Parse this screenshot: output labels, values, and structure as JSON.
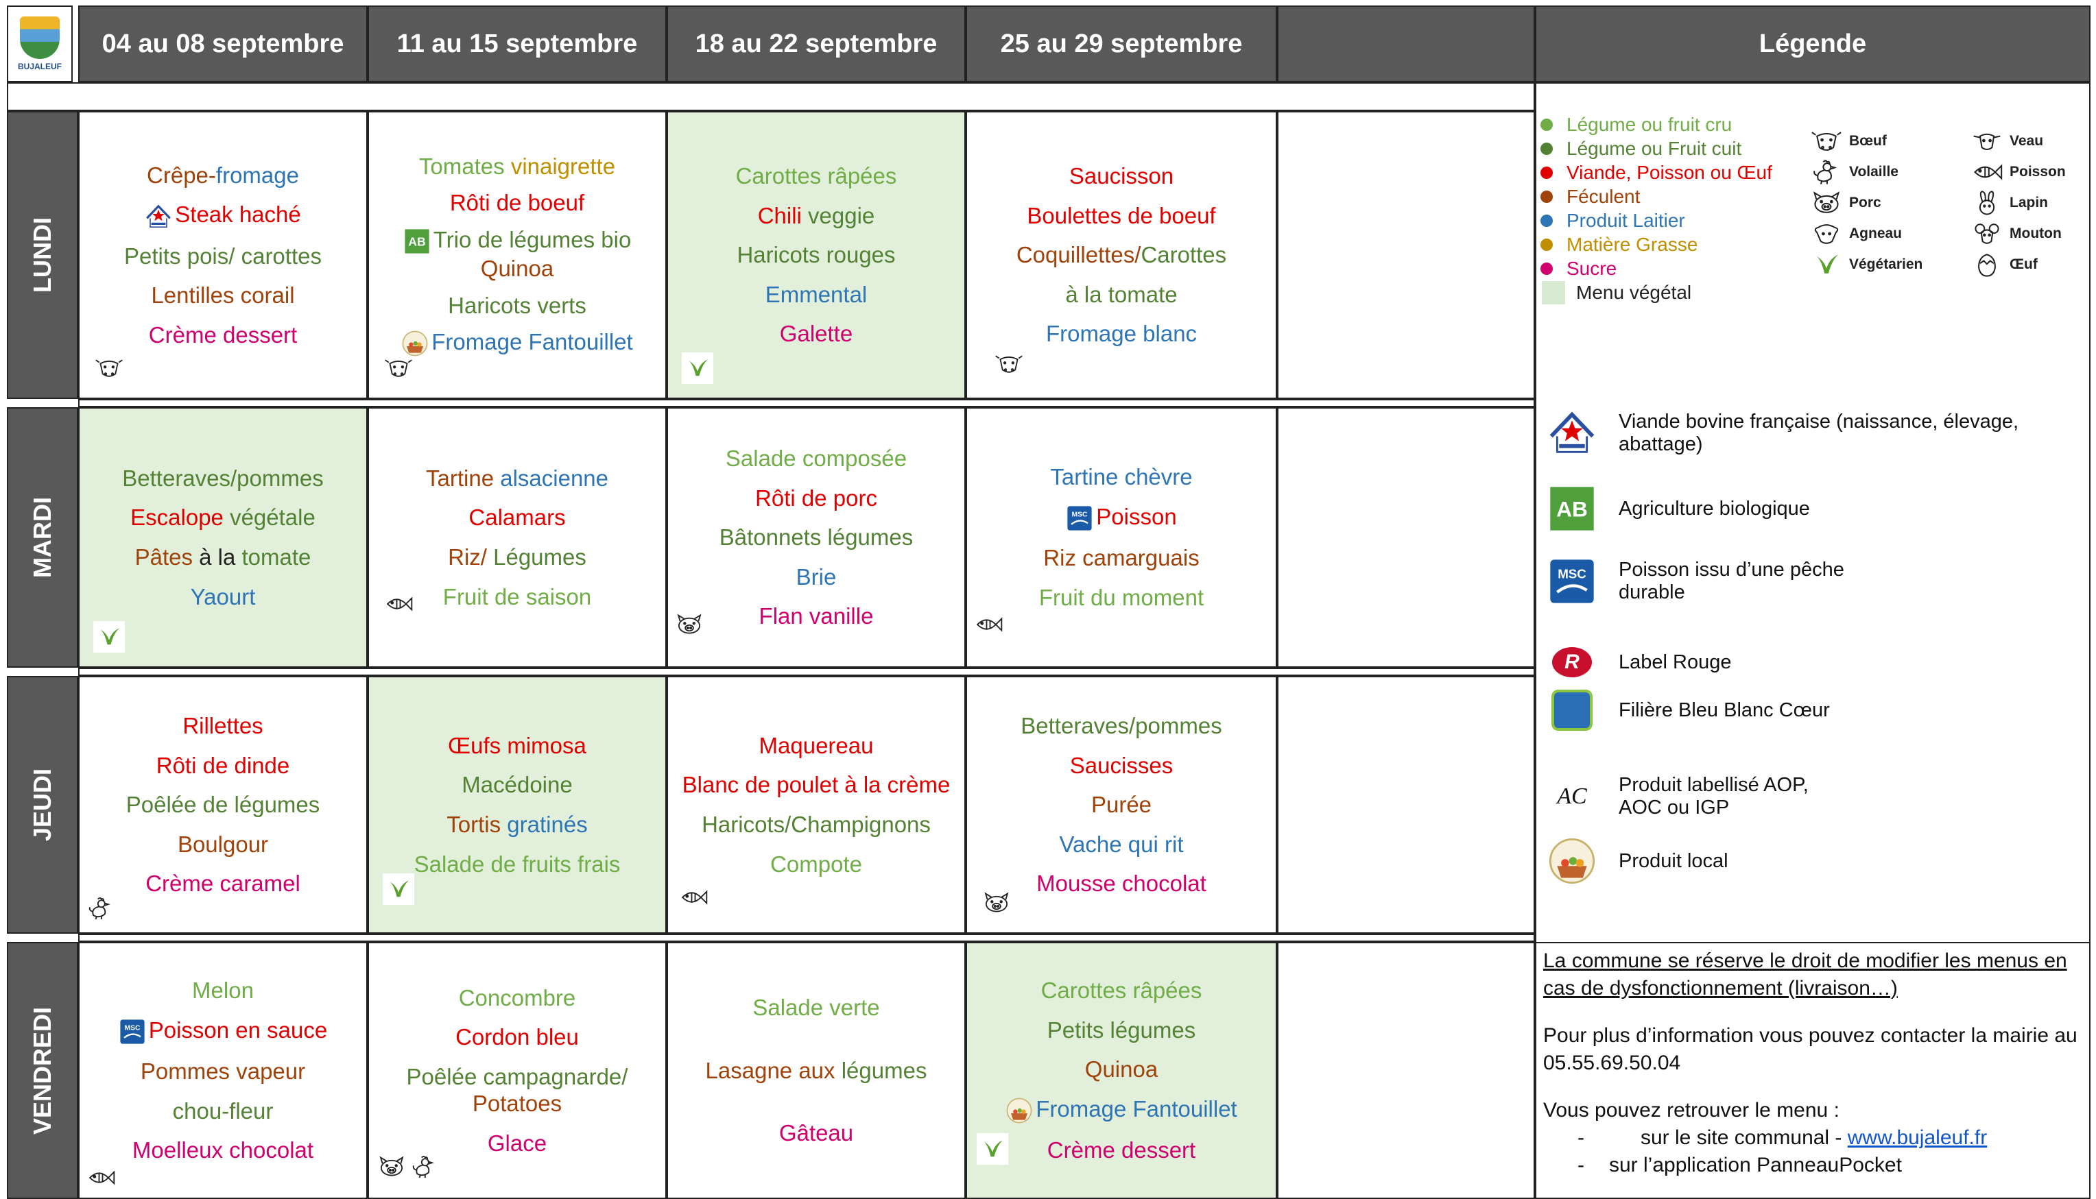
{
  "logo": {
    "text": "BUJALEUF"
  },
  "weeks": [
    "04 au 08 septembre",
    "11 au 15 septembre",
    "18 au 22 septembre",
    "25 au 29 septembre",
    ""
  ],
  "legend_title": "Légende",
  "days": [
    "LUNDI",
    "MARDI",
    "JEUDI",
    "VENDREDI"
  ],
  "colors": {
    "header_bg": "#595959",
    "vegetal_bg": "#e2efda",
    "cru": "#70ad47",
    "cuit": "#548235",
    "viande": "#e00000",
    "feculent": "#a0430a",
    "laitier": "#2e75b6",
    "grasse": "#bf8f00",
    "sucre": "#d0006f"
  },
  "menu": {
    "lundi": {
      "w1": {
        "l1a": "Crêpe-",
        "l1b": "fromage",
        "l2": "Steak haché",
        "l3": "Petits pois/ carottes",
        "l4": "Lentilles corail",
        "l5": "Crème dessert"
      },
      "w2": {
        "l1a": "Tomates ",
        "l1b": "vinaigrette",
        "l2": "Rôti de boeuf",
        "l3": "Trio de légumes bio",
        "l3b": "Quinoa",
        "l4": "Haricots verts",
        "l5": "Fromage Fantouillet"
      },
      "w3": {
        "l1": "Carottes râpées",
        "l2a": "Chili",
        "l2b": " veggie",
        "l3": "Haricots rouges",
        "l4": "Emmental",
        "l5": "Galette"
      },
      "w4": {
        "l1": "Saucisson",
        "l2": "Boulettes de boeuf",
        "l3a": "Coquillettes/",
        "l3b": "Carottes",
        "l4": "à la tomate",
        "l5": "Fromage blanc"
      }
    },
    "mardi": {
      "w1": {
        "l1": "Betteraves/pommes",
        "l2a": "Escalope",
        "l2b": " végétale",
        "l3a": "Pâtes ",
        "l3b": "à la ",
        "l3c": "tomate",
        "l4": "Yaourt"
      },
      "w2": {
        "l1a": "Tartine ",
        "l1b": "alsacienne",
        "l2": "Calamars",
        "l3a": "Riz/ ",
        "l3b": "Légumes",
        "l4": "Fruit de saison"
      },
      "w3": {
        "l1": "Salade composée",
        "l2": "Rôti de porc",
        "l3": "Bâtonnets légumes",
        "l4": "Brie",
        "l5": "Flan vanille"
      },
      "w4": {
        "l1": "Tartine chèvre",
        "l2": "Poisson",
        "l3": "Riz camarguais",
        "l4": "Fruit du moment"
      }
    },
    "jeudi": {
      "w1": {
        "l1": "Rillettes",
        "l2": "Rôti de dinde",
        "l3": "Poêlée de légumes",
        "l4": "Boulgour",
        "l5": "Crème caramel"
      },
      "w2": {
        "l1": "Œufs mimosa",
        "l2": "Macédoine",
        "l3a": "Tortis ",
        "l3b": "gratinés",
        "l4": "Salade de fruits frais"
      },
      "w3": {
        "l1": "Maquereau",
        "l2": "Blanc de poulet à la crème",
        "l3": "Haricots/Champignons",
        "l4": "Compote"
      },
      "w4": {
        "l1": "Betteraves/pommes",
        "l2": "Saucisses",
        "l3": "Purée",
        "l4": "Vache qui rit",
        "l5": "Mousse chocolat"
      }
    },
    "vendredi": {
      "w1": {
        "l1": "Melon",
        "l2": "Poisson en sauce",
        "l3": "Pommes vapeur",
        "l4": "chou-fleur",
        "l5": "Moelleux chocolat"
      },
      "w2": {
        "l1": "Concombre",
        "l2": "Cordon bleu",
        "l3": "Poêlée campagnarde/",
        "l3b": "Potatoes",
        "l4": "Glace"
      },
      "w3": {
        "l1": "Salade verte",
        "l2a": "Lasagne aux ",
        "l2b": "légumes",
        "l3": "Gâteau"
      },
      "w4": {
        "l1": "Carottes râpées",
        "l2": "Petits légumes",
        "l3": "Quinoa",
        "l4": "Fromage Fantouillet",
        "l5": "Crème dessert"
      }
    }
  },
  "legend": {
    "categories": [
      "Légume ou fruit cru",
      "Légume ou Fruit cuit",
      "Viande, Poisson ou Œuf",
      "Féculent",
      "Produit Laitier",
      "Matière Grasse",
      "Sucre"
    ],
    "vegetal": "Menu végétal",
    "animals": [
      {
        "label": "Bœuf",
        "icon": "cow-icon"
      },
      {
        "label": "Veau",
        "icon": "calf-icon"
      },
      {
        "label": "Volaille",
        "icon": "chicken-icon"
      },
      {
        "label": "Poisson",
        "icon": "fish-icon"
      },
      {
        "label": "Porc",
        "icon": "pig-icon"
      },
      {
        "label": "Lapin",
        "icon": "rabbit-icon"
      },
      {
        "label": "Agneau",
        "icon": "lamb-icon"
      },
      {
        "label": "Mouton",
        "icon": "sheep-icon"
      },
      {
        "label": "Végétarien",
        "icon": "leaf-icon"
      },
      {
        "label": "Œuf",
        "icon": "egg-icon"
      }
    ],
    "labels": [
      {
        "text": "Viande bovine française (naissance, élevage, abattage)",
        "icon": "viande-bovine-francaise-icon"
      },
      {
        "text": "Agriculture biologique",
        "icon": "ab-logo-icon"
      },
      {
        "text": "Poisson issu d’une pêche durable",
        "icon": "msc-logo-icon"
      },
      {
        "text": "Label Rouge",
        "icon": "label-rouge-icon"
      },
      {
        "text": "Filière Bleu Blanc Cœur",
        "icon": "bleu-blanc-coeur-icon"
      },
      {
        "text": "Produit labellisé AOP, AOC ou IGP",
        "icon": "aoc-icon"
      },
      {
        "text": "Produit local",
        "icon": "produit-local-icon"
      }
    ]
  },
  "info": {
    "notice": "La commune se réserve le droit de modifier les menus en cas de dysfonctionnement (livraison…)",
    "contact": "Pour plus d’information vous pouvez contacter la mairie au 05.55.69.50.04",
    "retrieve": "Vous pouvez retrouver le menu :",
    "site_prefix": "sur le site communal - ",
    "site_link": "www.bujaleuf.fr",
    "app": "sur l’application PanneauPocket"
  }
}
